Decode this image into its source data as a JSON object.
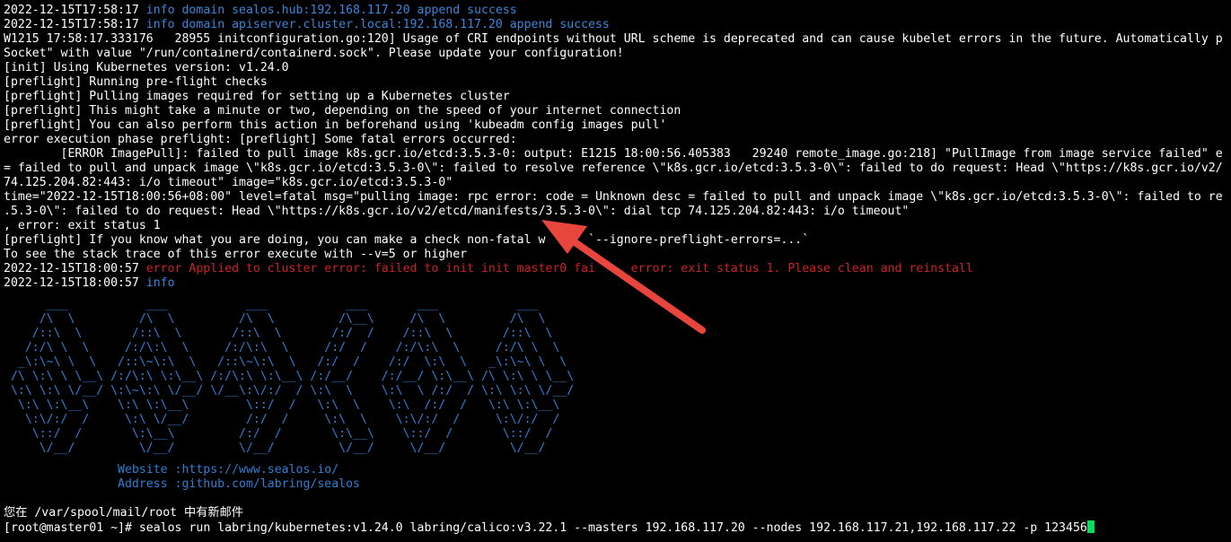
{
  "terminal": {
    "lines": [
      {
        "segments": [
          {
            "t": "2022-12-15T17:58:17 ",
            "c": ""
          },
          {
            "t": "info domain sealos.hub:192.168.117.20 append success",
            "c": "blue"
          }
        ]
      },
      {
        "segments": [
          {
            "t": "2022-12-15T17:58:17 ",
            "c": ""
          },
          {
            "t": "info domain apiserver.cluster.local:192.168.117.20 append success",
            "c": "blue"
          }
        ]
      },
      {
        "segments": [
          {
            "t": "W1215 17:58:17.333176   28955 initconfiguration.go:120] Usage of CRI endpoints without URL scheme is deprecated and can cause kubelet errors in the future. Automatically p",
            "c": ""
          }
        ]
      },
      {
        "segments": [
          {
            "t": "Socket\" with value \"/run/containerd/containerd.sock\". Please update your configuration!",
            "c": ""
          }
        ]
      },
      {
        "segments": [
          {
            "t": "[init] Using Kubernetes version: v1.24.0",
            "c": ""
          }
        ]
      },
      {
        "segments": [
          {
            "t": "[preflight] Running pre-flight checks",
            "c": ""
          }
        ]
      },
      {
        "segments": [
          {
            "t": "[preflight] Pulling images required for setting up a Kubernetes cluster",
            "c": ""
          }
        ]
      },
      {
        "segments": [
          {
            "t": "[preflight] This might take a minute or two, depending on the speed of your internet connection",
            "c": ""
          }
        ]
      },
      {
        "segments": [
          {
            "t": "[preflight] You can also perform this action in beforehand using 'kubeadm config images pull'",
            "c": ""
          }
        ]
      },
      {
        "segments": [
          {
            "t": "error execution phase preflight: [preflight] Some fatal errors occurred:",
            "c": ""
          }
        ]
      },
      {
        "segments": [
          {
            "t": "        [ERROR ImagePull]: failed to pull image k8s.gcr.io/etcd:3.5.3-0: output: E1215 18:00:56.405383   29240 remote_image.go:218] \"PullImage from image service failed\" e",
            "c": ""
          }
        ]
      },
      {
        "segments": [
          {
            "t": "= failed to pull and unpack image \\\"k8s.gcr.io/etcd:3.5.3-0\\\": failed to resolve reference \\\"k8s.gcr.io/etcd:3.5.3-0\\\": failed to do request: Head \\\"https://k8s.gcr.io/v2/",
            "c": ""
          }
        ]
      },
      {
        "segments": [
          {
            "t": "74.125.204.82:443: i/o timeout\" image=\"k8s.gcr.io/etcd:3.5.3-0\"",
            "c": ""
          }
        ]
      },
      {
        "segments": [
          {
            "t": "time=\"2022-12-15T18:00:56+08:00\" level=fatal msg=\"pulling image: rpc error: code = Unknown desc = failed to pull and unpack image \\\"k8s.gcr.io/etcd:3.5.3-0\\\": failed to re",
            "c": ""
          }
        ]
      },
      {
        "segments": [
          {
            "t": ".5.3-0\\\": failed to do request: Head \\\"https://k8s.gcr.io/v2/etcd/manifests/3.5.3-0\\\": dial tcp 74.125.204.82:443: i/o timeout\"",
            "c": ""
          }
        ]
      },
      {
        "segments": [
          {
            "t": ", error: exit status 1",
            "c": ""
          }
        ]
      },
      {
        "segments": [
          {
            "t": "[preflight] If you know what you are doing, you can make a check non-fatal w      `--ignore-preflight-errors=...`",
            "c": ""
          }
        ]
      },
      {
        "segments": [
          {
            "t": "To see the stack trace of this error execute with --v=5 or higher",
            "c": ""
          }
        ]
      },
      {
        "segments": [
          {
            "t": "2022-12-15T18:00:57 ",
            "c": ""
          },
          {
            "t": "error Applied to cluster error: failed to init init master0 fai     error: exit status 1. Please clean and reinstall",
            "c": "red"
          }
        ]
      },
      {
        "segments": [
          {
            "t": "2022-12-15T18:00:57 ",
            "c": ""
          },
          {
            "t": "info",
            "c": "blue"
          }
        ]
      }
    ],
    "banner": [
      "      ___           ___           ___           ___       ___           ___     ",
      "     /\\  \\         /\\  \\         /\\  \\         /\\__\\     /\\  \\         /\\  \\    ",
      "    /::\\  \\       /::\\  \\       /::\\  \\       /:/  /    /::\\  \\       /::\\  \\   ",
      "   /:/\\ \\  \\     /:/\\:\\  \\     /:/\\:\\  \\     /:/  /    /:/\\:\\  \\     /:/\\ \\  \\  ",
      "  _\\:\\~\\ \\  \\   /::\\~\\:\\  \\   /::\\~\\:\\  \\   /:/  /    /:/  \\:\\  \\   _\\:\\~\\ \\  \\ ",
      " /\\ \\:\\ \\ \\__\\ /:/\\:\\ \\:\\__\\ /:/\\:\\ \\:\\__\\ /:/__/    /:/__/ \\:\\__\\ /\\ \\:\\ \\ \\__\\",
      " \\:\\ \\:\\ \\/__/ \\:\\~\\:\\ \\/__/ \\/__\\:\\/:/  / \\:\\  \\    \\:\\  \\ /:/  / \\:\\ \\:\\ \\/__/",
      "  \\:\\ \\:\\__\\    \\:\\ \\:\\__\\        \\::/  /   \\:\\  \\    \\:\\  /:/  /   \\:\\ \\:\\__\\  ",
      "   \\:\\/:/  /     \\:\\ \\/__/        /:/  /     \\:\\  \\    \\:\\/:/  /     \\:\\/:/  /  ",
      "    \\::/  /       \\:\\__\\         /:/  /       \\:\\__\\    \\::/  /       \\::/  /   ",
      "     \\/__/         \\/__/         \\/__/         \\/__/     \\/__/         \\/__/    "
    ],
    "website": "                Website :https://www.sealos.io/",
    "address": "                Address :github.com/labring/sealos",
    "mail_notice": "您在 /var/spool/mail/root 中有新邮件",
    "prompt": "[root@master01 ~]# ",
    "command": "sealos run labring/kubernetes:v1.24.0 labring/calico:v3.22.1 --masters 192.168.117.20 --nodes 192.168.117.21,192.168.117.22 -p 123456"
  },
  "colors": {
    "background": "#000000",
    "text": "#ffffff",
    "info": "#3a86d8",
    "error": "#cc2222",
    "banner": "#2f7fd3",
    "cursor": "#00e05a",
    "arrow": "#e8453c"
  }
}
